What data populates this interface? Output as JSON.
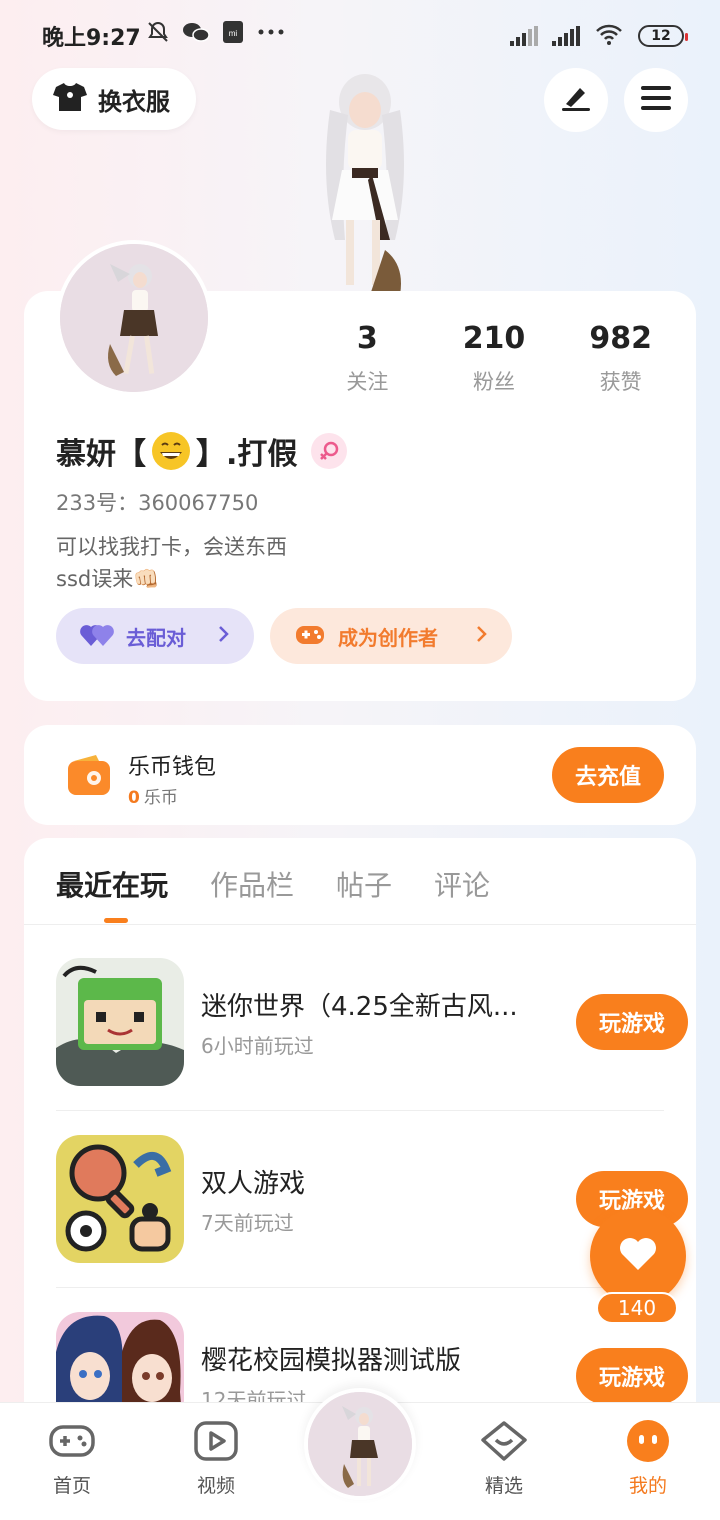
{
  "status_bar": {
    "time": "晚上9:27",
    "battery": "12",
    "icons": [
      "bell-off-icon",
      "wechat-icon",
      "mi-icon",
      "more-icon",
      "signal-icon",
      "signal-icon",
      "wifi-icon"
    ]
  },
  "header": {
    "outfit_label": "换衣服"
  },
  "profile": {
    "stats": [
      {
        "value": "3",
        "label": "关注"
      },
      {
        "value": "210",
        "label": "粉丝"
      },
      {
        "value": "982",
        "label": "获赞"
      }
    ],
    "nickname_prefix": "慕妍【",
    "nickname_suffix": "】.打假",
    "uid": "233号：360067750",
    "bio_line1": "可以找我打卡，会送东西",
    "bio_line2": "ssd误来👊🏻",
    "pair_label": "去配对",
    "creator_label": "成为创作者"
  },
  "wallet": {
    "title": "乐币钱包",
    "balance": "0",
    "unit": "乐币",
    "recharge_label": "去充值"
  },
  "tabs": [
    "最近在玩",
    "作品栏",
    "帖子",
    "评论"
  ],
  "games": [
    {
      "title": "迷你世界（4.25全新古风...",
      "sub": "6小时前玩过",
      "button": "玩游戏"
    },
    {
      "title": "双人游戏",
      "sub": "7天前玩过",
      "button": "玩游戏"
    },
    {
      "title": "樱花校园模拟器测试版",
      "sub": "12天前玩过",
      "button": "玩游戏"
    }
  ],
  "fab": {
    "count": "140"
  },
  "bottom_nav": [
    {
      "label": "首页"
    },
    {
      "label": "视频"
    },
    {
      "label": "精选"
    },
    {
      "label": "我的"
    }
  ],
  "colors": {
    "accent": "#f97f1d",
    "pair": "#6a5dd6",
    "creator": "#f27b2e"
  }
}
